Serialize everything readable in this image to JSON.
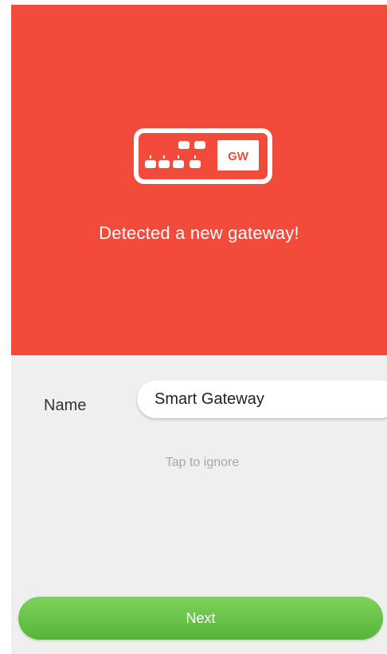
{
  "header": {
    "icon": "gateway-device-icon",
    "icon_badge": "GW",
    "title": "Detected a new gateway!"
  },
  "form": {
    "name_label": "Name",
    "name_value": "Smart Gateway",
    "ignore_label": "Tap to ignore",
    "next_label": "Next"
  },
  "colors": {
    "hero_background": "#f24b3b",
    "form_background": "#efefef",
    "button_green": "#5cb83f",
    "muted_text": "#a7a7a7"
  }
}
